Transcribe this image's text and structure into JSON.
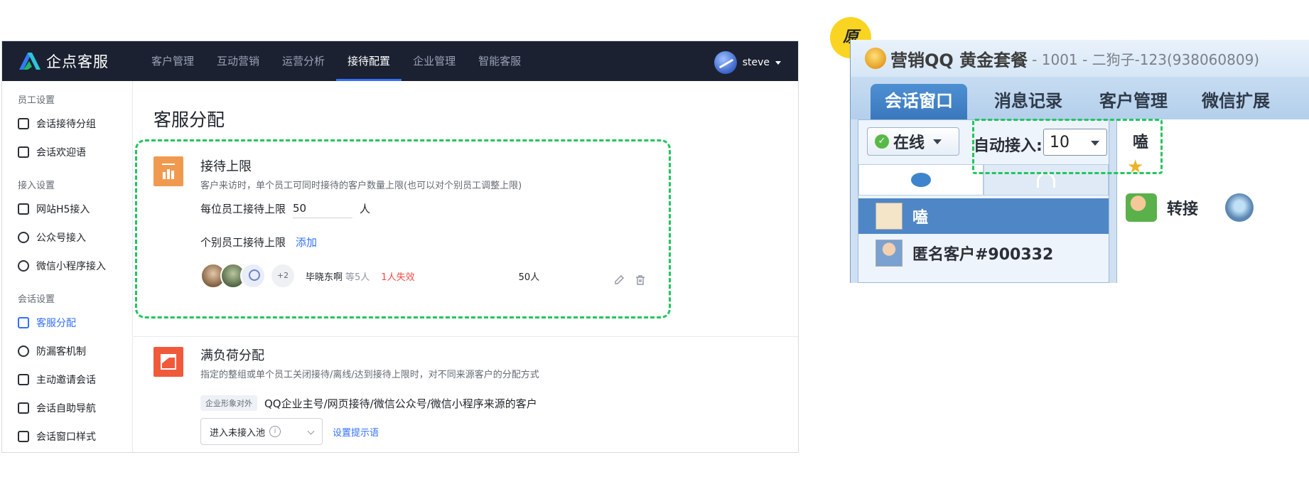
{
  "app": {
    "logo_text": "企点客服",
    "nav": [
      "客户管理",
      "互动营销",
      "运营分析",
      "接待配置",
      "企业管理",
      "智能客服"
    ],
    "user": "steve"
  },
  "sidebar": {
    "groups": [
      {
        "title": "员工设置",
        "items": [
          "会话接待分组",
          "会话欢迎语"
        ]
      },
      {
        "title": "接入设置",
        "items": [
          "网站H5接入",
          "公众号接入",
          "微信小程序接入"
        ]
      },
      {
        "title": "会话设置",
        "items": [
          "客服分配",
          "防漏客机制",
          "主动邀请会话",
          "会话自助导航",
          "会话窗口样式"
        ]
      }
    ]
  },
  "page": {
    "title": "客服分配",
    "limit": {
      "title": "接待上限",
      "desc": "客户来访时，单个员工可同时接待的客户数量上限(也可以对个别员工调整上限)",
      "per_label": "每位员工接待上限",
      "per_value": "50",
      "per_unit": "人",
      "indiv_label": "个别员工接待上限",
      "add_link": "添加",
      "more_count": "+2",
      "names": "毕晓东啊",
      "names_more": "等5人",
      "invalid": "1人失效",
      "value": "50人"
    },
    "overload": {
      "title": "满负荷分配",
      "desc": "指定的整组或单个员工关闭接待/离线/达到接待上限时，对不同来源客户的分配方式",
      "tag": "企业形象对外",
      "sources": "QQ企业主号/网页接待/微信公众号/微信小程序来源的客户",
      "select_value": "进入未接入池",
      "hint_link": "设置提示语"
    }
  },
  "badge": "原",
  "qq": {
    "title_main": "营销QQ 黄金套餐",
    "title_sub": "- 1001 - 二狗子-123(938060809)",
    "tabs": [
      "会话窗口",
      "消息记录",
      "客户管理",
      "微信扩展"
    ],
    "status": "在线",
    "auto_label": "自动接入:",
    "auto_value": "10",
    "contacts": [
      "嗑",
      "匿名客户#900332"
    ],
    "right_name": "嗑",
    "transfer": "转接"
  }
}
